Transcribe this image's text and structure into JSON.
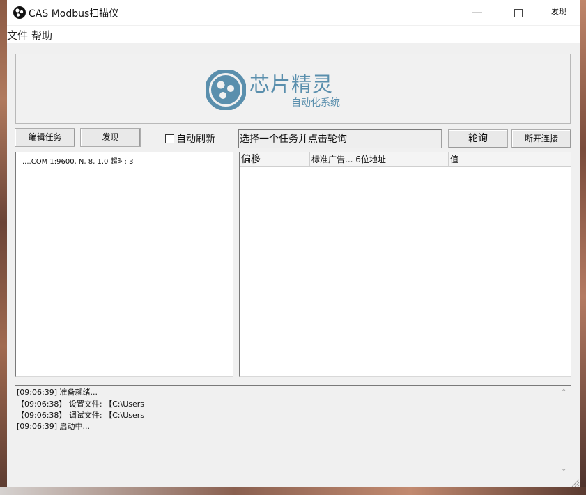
{
  "window": {
    "title": "CAS Modbus扫描仪",
    "titlebar_right": "发现",
    "icon": "app-logo-icon"
  },
  "menu": {
    "items": [
      {
        "label": "文件"
      },
      {
        "label": "帮助"
      }
    ]
  },
  "banner": {
    "title": "芯片精灵",
    "subtitle": "自动化系统",
    "accent": "#5a8fad"
  },
  "toolbar": {
    "edit_task_label": "编辑任务",
    "discover_label": "发现",
    "auto_refresh_label": "自动刷新",
    "auto_refresh_checked": false,
    "prompt_text": "选择一个任务并点击轮询",
    "poll_label": "轮询",
    "disconnect_label": "断开连接"
  },
  "tasks": [
    {
      "label": "....COM 1:9600, N, 8, 1.0 超时: 3"
    }
  ],
  "table": {
    "columns": [
      {
        "label": "偏移"
      },
      {
        "label": "标准广告... 6位地址"
      },
      {
        "label": "值"
      },
      {
        "label": ""
      }
    ],
    "rows": []
  },
  "log": {
    "lines": [
      "[09:06:39] 准备就绪...",
      "【09:06:38】 设置文件: 【C:\\Users",
      "【09:06:38】 调试文件: 【C:\\Users",
      "[09:06:39] 启动中..."
    ]
  }
}
